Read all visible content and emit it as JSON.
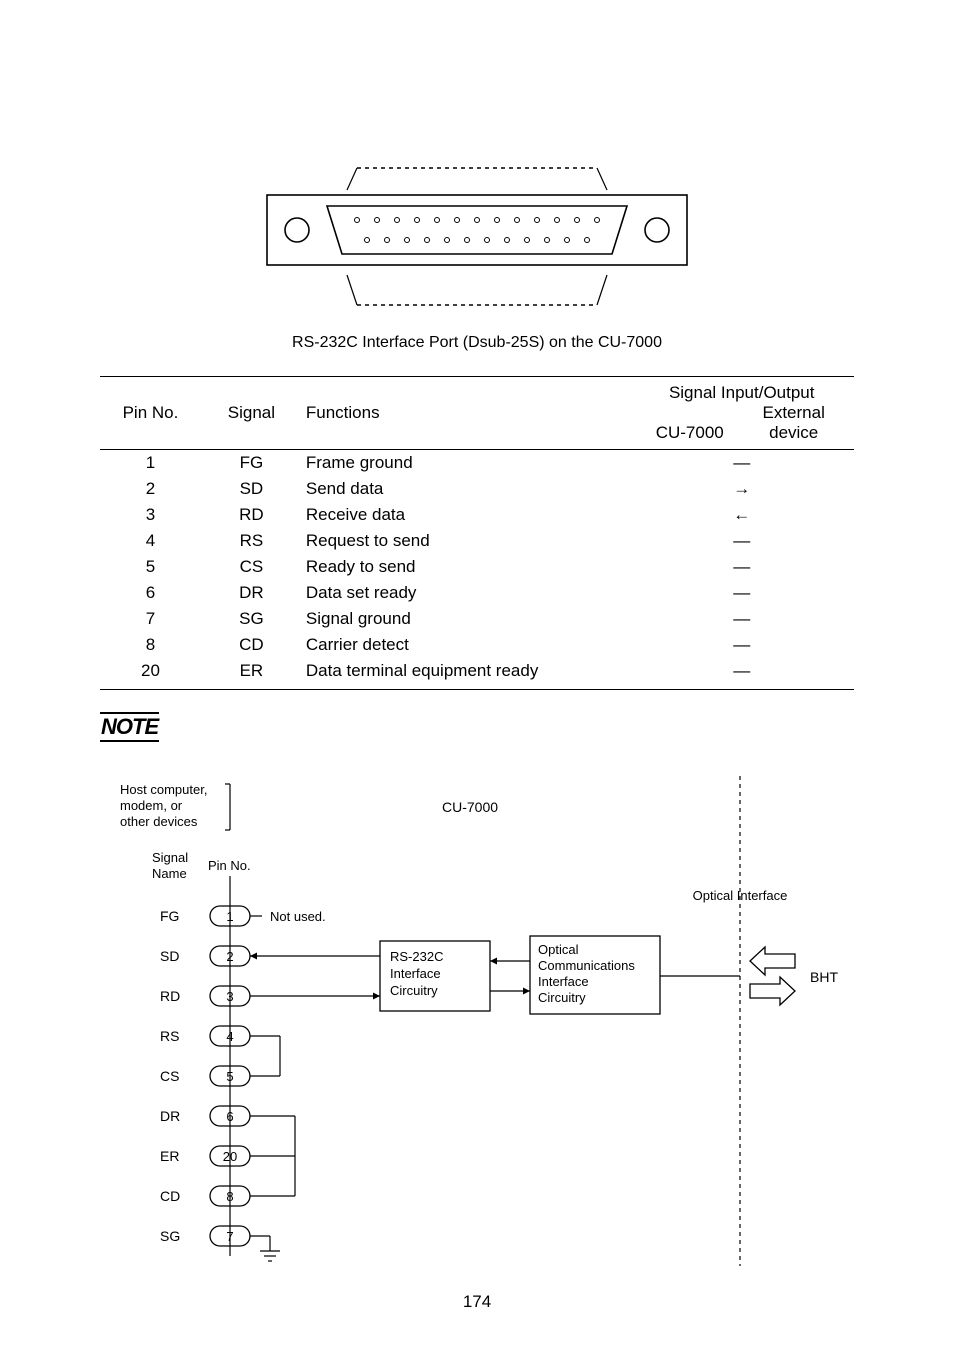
{
  "connector": {
    "caption": "RS-232C Interface Port (Dsub-25S) on the CU-7000"
  },
  "table": {
    "headers": {
      "pin": "Pin No.",
      "signal": "Signal",
      "functions": "Functions",
      "io_title": "Signal Input/Output",
      "io_left": "CU-7000",
      "io_right": "External device"
    },
    "rows": [
      {
        "pin": "1",
        "signal": "FG",
        "func": "Frame ground",
        "io": "—"
      },
      {
        "pin": "2",
        "signal": "SD",
        "func": "Send data",
        "io": "→"
      },
      {
        "pin": "3",
        "signal": "RD",
        "func": "Receive data",
        "io": "←"
      },
      {
        "pin": "4",
        "signal": "RS",
        "func": "Request to send",
        "io": "—"
      },
      {
        "pin": "5",
        "signal": "CS",
        "func": "Ready to send",
        "io": "—"
      },
      {
        "pin": "6",
        "signal": "DR",
        "func": "Data set ready",
        "io": "—"
      },
      {
        "pin": "7",
        "signal": "SG",
        "func": "Signal ground",
        "io": "—"
      },
      {
        "pin": "8",
        "signal": "CD",
        "func": "Carrier detect",
        "io": "—"
      },
      {
        "pin": "20",
        "signal": "ER",
        "func": "Data terminal equipment ready",
        "io": "—"
      }
    ]
  },
  "note_label": "NOTE",
  "diagram": {
    "host_label": "Host computer,\nmodem, or\nother devices",
    "cu_label": "CU-7000",
    "signal_name_label": "Signal\nName",
    "pin_label": "Pin No.",
    "not_used_label": "Not used.",
    "rs232_block": "RS-232C\nInterface\nCircuitry",
    "optical_block": "Optical\nCommunications\nInterface\nCircuitry",
    "optical_interface_label": "Optical Interface",
    "bht_label": "BHT",
    "signals": [
      {
        "name": "FG",
        "pin": "1"
      },
      {
        "name": "SD",
        "pin": "2"
      },
      {
        "name": "RD",
        "pin": "3"
      },
      {
        "name": "RS",
        "pin": "4"
      },
      {
        "name": "CS",
        "pin": "5"
      },
      {
        "name": "DR",
        "pin": "6"
      },
      {
        "name": "ER",
        "pin": "20"
      },
      {
        "name": "CD",
        "pin": "8"
      },
      {
        "name": "SG",
        "pin": "7"
      }
    ]
  },
  "page_number": "174"
}
